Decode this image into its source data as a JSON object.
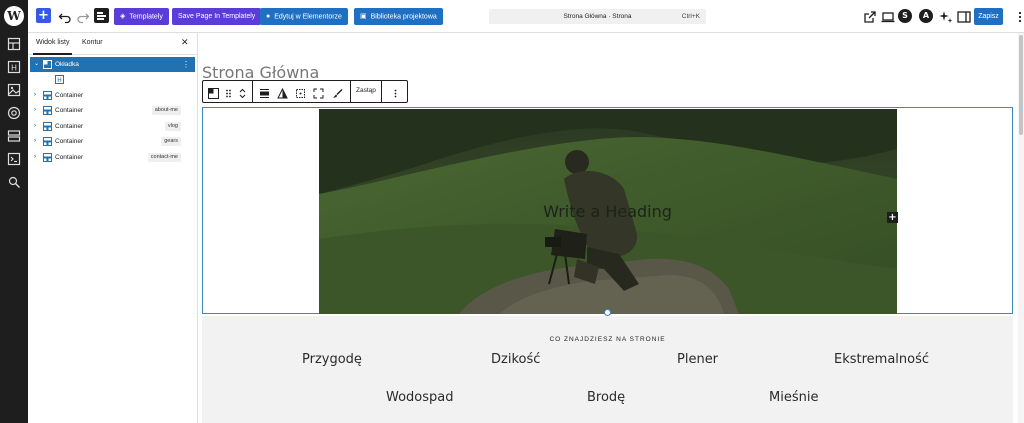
{
  "toolbar": {
    "templately_label": "Templately",
    "save_templately_label": "Save Page In Templately",
    "elementor_label": "Edytuj w Elementorze",
    "library_label": "Biblioteka projektowa",
    "command_title": "Strona Główna · Strona",
    "command_shortcut": "Ctrl+K",
    "save_label": "Zapisz"
  },
  "listview": {
    "tab_list": "Widok listy",
    "tab_outline": "Kontur",
    "rows": [
      {
        "label": "Okładka",
        "badge": ""
      },
      {
        "label": "Container",
        "badge": ""
      },
      {
        "label": "Container",
        "badge": "about-me"
      },
      {
        "label": "Container",
        "badge": "vlog"
      },
      {
        "label": "Container",
        "badge": "gears"
      },
      {
        "label": "Container",
        "badge": "contact-me"
      }
    ]
  },
  "canvas": {
    "page_title": "Strona Główna",
    "replace_label": "Zastąp",
    "cover_heading": "Write a Heading",
    "section_label": "CO ZNAJDZIESZ NA STRONIE",
    "keywords_row1": [
      "Przygodę",
      "Dzikość",
      "Plener",
      "Ekstremalność"
    ],
    "keywords_row2": [
      "Wodospad",
      "Brodę",
      "Mieśnie"
    ]
  },
  "colors": {
    "accent": "#3858e9",
    "purple": "#5b3cd8",
    "blue": "#1f6fc2",
    "selected_row": "#2271b1"
  }
}
